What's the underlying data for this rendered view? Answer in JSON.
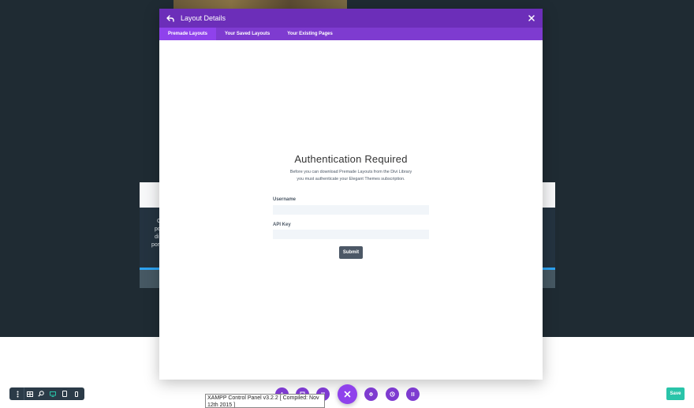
{
  "background": {
    "fragments_left": [
      "C",
      "po",
      "di",
      "port"
    ],
    "fragments_right": [
      "",
      ""
    ]
  },
  "modal": {
    "title": "Layout Details",
    "tabs": [
      {
        "label": "Premade Layouts",
        "active": true
      },
      {
        "label": "Your Saved Layouts",
        "active": false
      },
      {
        "label": "Your Existing Pages",
        "active": false
      }
    ],
    "auth": {
      "title": "Authentication Required",
      "description": "Before you can download Premade Layouts from the Divi Library you must authenticate your Elegant Themes subscription.",
      "username_label": "Username",
      "username_value": "",
      "api_key_label": "API Key",
      "api_key_value": "",
      "submit_label": "Submit"
    }
  },
  "view_toolbar": {
    "icons": [
      "more-icon",
      "wireframe-icon",
      "zoom-icon",
      "desktop-icon",
      "tablet-icon",
      "phone-icon"
    ],
    "active": "desktop-icon"
  },
  "fab_bar": {
    "icons": [
      "add-icon",
      "layers-icon",
      "portability-icon",
      "close-icon",
      "settings-icon",
      "history-icon",
      "sort-icon"
    ]
  },
  "xampp_tooltip": {
    "text": "XAMPP Control Panel v3.2.2     [ Compiled: Nov 12th 2015 ]"
  },
  "save_button": {
    "label": "Save"
  },
  "colors": {
    "header_purple": "#6c2eb9",
    "tab_purple": "#7e3bd0",
    "active_tab": "#8f42ec",
    "save_green": "#29c4a9",
    "dark_bg": "#1f2b33"
  }
}
